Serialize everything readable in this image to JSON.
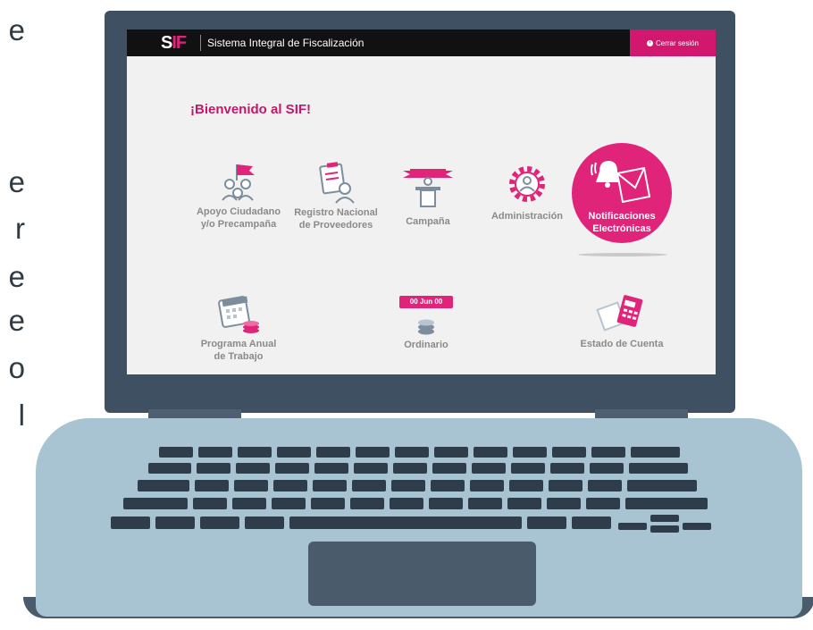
{
  "side_fragments": [
    "e",
    "e",
    "r",
    "e",
    "e",
    "o",
    "l"
  ],
  "header": {
    "logo_main": "S",
    "logo_accent": "IF",
    "app_title": "Sistema Integral de Fiscalización",
    "logout_label": "Cerrar sesión"
  },
  "welcome": "¡Bienvenido al SIF!",
  "modules": {
    "apoyo": {
      "line1": "Apoyo Ciudadano",
      "line2": "y/o Precampaña",
      "icon": "people-flag-icon"
    },
    "registro": {
      "line1": "Registro Nacional",
      "line2": "de Proveedores",
      "icon": "clipboard-user-icon"
    },
    "campana": {
      "line1": "Campaña",
      "icon": "podium-icon"
    },
    "administracion": {
      "line1": "Administración",
      "icon": "gear-user-icon"
    },
    "notificaciones": {
      "line1": "Notificaciones",
      "line2": "Electrónicas",
      "icon": "bell-envelope-icon"
    },
    "programa": {
      "line1": "Programa Anual",
      "line2": "de Trabajo",
      "icon": "calendar-coins-icon"
    },
    "ordinario": {
      "line1": "Ordinario",
      "badge": "00 Jun 00",
      "icon": "coin-stack-icon"
    },
    "estado": {
      "line1": "Estado de Cuenta",
      "icon": "calculator-icon"
    }
  },
  "colors": {
    "accent": "#e0247a",
    "topbar": "#111111",
    "screen_bg": "#f1f1f1",
    "laptop_lid": "#3f5062",
    "laptop_base": "#a8c3d1"
  }
}
